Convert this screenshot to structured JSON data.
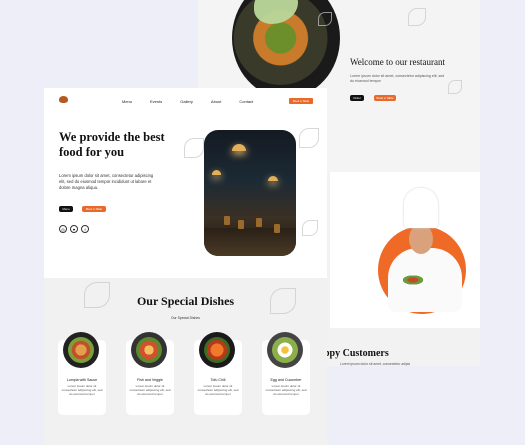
{
  "back": {
    "title": "Welcome to our restaurant",
    "text": "Lorem ipsum dolor sit amet, consectetur adipiscing elit, sed do eiusmod tempor",
    "btn_dark": "Order",
    "btn_orange": "Book a Table",
    "customers_title": "ppy Customers",
    "customers_text": "Lorem ipsum dolor sit amet, consectetur adipiscing elit, sed"
  },
  "nav": {
    "items": [
      "Menu",
      "Events",
      "Gallery",
      "About",
      "Contact"
    ],
    "cta": "Book a Table"
  },
  "hero": {
    "title": "We provide the best food for you",
    "text": "Lorem ipsum dolor sit amet, consectetur adipiscing elit, sed do eiusmod tempor incididunt ut labore et dolore magna aliqua.",
    "btn_dark": "Menu",
    "btn_orange": "Book a Table",
    "socials": [
      "◎",
      "♥",
      "f"
    ]
  },
  "specials": {
    "title": "Our Special Dishes",
    "subtitle": "Our Special Dishes",
    "dishes": [
      {
        "name": "Lumpia with Sauce",
        "desc": "Lorem ipsum dolor sit consectetur adipiscing elit, sed do eiusmod tempor"
      },
      {
        "name": "Fish and Veggie",
        "desc": "Lorem ipsum dolor sit consectetur adipiscing elit, sed do eiusmod tempor"
      },
      {
        "name": "Tofu Chili",
        "desc": "Lorem ipsum dolor sit consectetur adipiscing elit, sed do eiusmod tempor"
      },
      {
        "name": "Egg and Cucumber",
        "desc": "Lorem ipsum dolor sit consectetur adipiscing elit, sed do eiusmod tempor"
      }
    ]
  },
  "colors": {
    "accent": "#e8692a",
    "dark": "#111111",
    "page_bg": "#eeeef8"
  }
}
